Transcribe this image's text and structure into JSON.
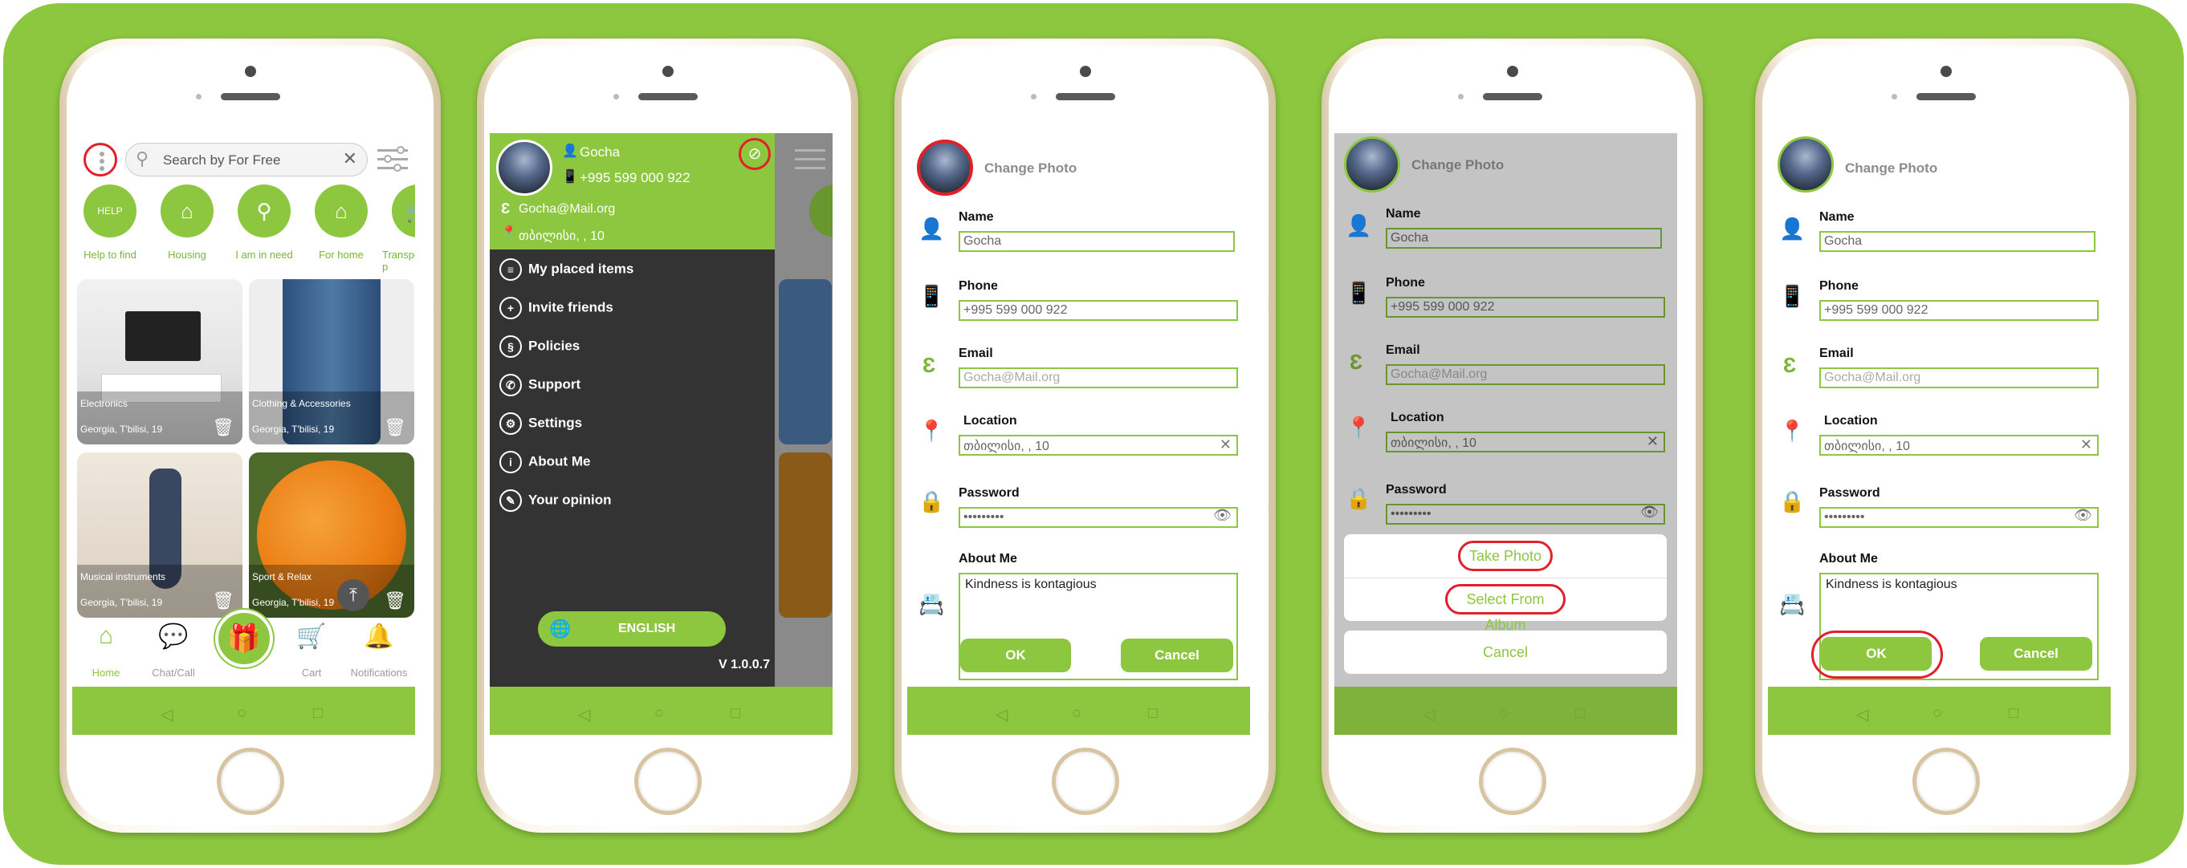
{
  "colors": {
    "brand_green": "#8dc63f",
    "highlight_red": "#e0202a",
    "drawer_dark": "#333333"
  },
  "home": {
    "search_placeholder": "Search by For Free",
    "categories": [
      {
        "label": "Help to find",
        "icon": "help-badge-icon",
        "glyph": "HELP"
      },
      {
        "label": "Housing",
        "icon": "housing-icon",
        "glyph": "⌂"
      },
      {
        "label": "I am in need",
        "icon": "magnifier-icon",
        "glyph": "⚲"
      },
      {
        "label": "For home",
        "icon": "home-icon",
        "glyph": "⌂"
      },
      {
        "label": "Transpo & p",
        "icon": "cart-icon",
        "glyph": "🛒"
      }
    ],
    "cards": [
      {
        "title": "Electronics",
        "location": "Georgia, T'bilisi, 19"
      },
      {
        "title": "Clothing & Accessories",
        "location": "Georgia, T'bilisi, 19"
      },
      {
        "title": "Musical instruments",
        "location": "Georgia, T'bilisi, 19"
      },
      {
        "title": "Sport & Relax",
        "location": "Georgia, T'bilisi, 19"
      }
    ],
    "tabs": [
      {
        "label": "Home",
        "icon": "home-icon"
      },
      {
        "label": "Chat/Call",
        "icon": "chat-icon"
      },
      {
        "label": "Cart",
        "icon": "cart-icon"
      },
      {
        "label": "Notifications",
        "icon": "bell-icon"
      }
    ]
  },
  "drawer": {
    "name": "Gocha",
    "phone": "+995 599 000 922",
    "email": "Gocha@Mail.org",
    "location": "თბილისი, , 10",
    "items": [
      {
        "label": "My placed items",
        "icon": "list-icon"
      },
      {
        "label": "Invite friends",
        "icon": "add-user-icon"
      },
      {
        "label": "Policies",
        "icon": "policy-icon"
      },
      {
        "label": "Support",
        "icon": "phone-support-icon"
      },
      {
        "label": "Settings",
        "icon": "gear-icon"
      },
      {
        "label": "About Me",
        "icon": "info-icon"
      },
      {
        "label": "Your opinion",
        "icon": "opinion-icon"
      }
    ],
    "language": "ENGLISH",
    "version": "V 1.0.0.7"
  },
  "form": {
    "title": "Change Photo",
    "name_label": "Name",
    "name_value": "Gocha",
    "phone_label": "Phone",
    "phone_value": "+995 599 000 922",
    "email_label": "Email",
    "email_value": "Gocha@Mail.org",
    "location_label": "Location",
    "location_value": "თბილისი, , 10",
    "password_label": "Password",
    "password_value": "•••••••••",
    "about_label": "About Me",
    "about_value": "Kindness is kontagious",
    "ok": "OK",
    "cancel": "Cancel"
  },
  "photo_sheet": {
    "take_photo": "Take Photo",
    "select_album": "Select From Album",
    "cancel": "Cancel"
  }
}
